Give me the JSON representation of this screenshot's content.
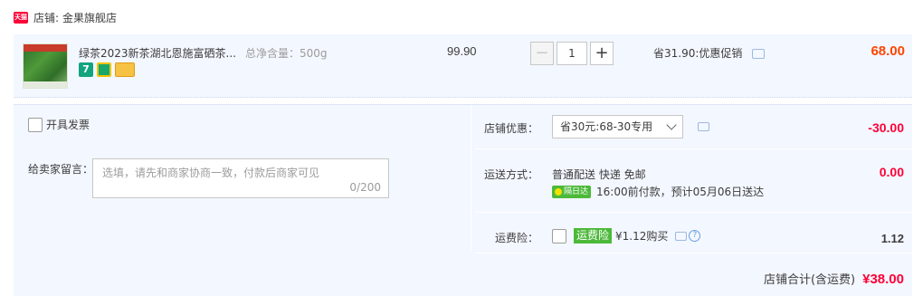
{
  "shop": {
    "badge_text": "天猫",
    "prefix": "店铺:",
    "name": "金果旗舰店"
  },
  "item": {
    "title": "绿茶2023新茶湖北恩施富硒茶...",
    "spec": "总净含量：500g",
    "unit_price": "99.90",
    "quantity": "1",
    "qty_minus": "−",
    "qty_plus": "+",
    "promo": "省31.90:优惠促销",
    "total": "68.00",
    "tag_icons": [
      "seven-day-return-icon",
      "shield-badge-icon",
      "card-icon"
    ],
    "tag1_text": "7"
  },
  "invoice": {
    "label": "开具发票"
  },
  "message": {
    "label": "给卖家留言：",
    "placeholder": "选填，请先和商家协商一致，付款后商家可见",
    "count": "0/200"
  },
  "coupon": {
    "label": "店铺优惠：",
    "selected": "省30元:68-30专用",
    "amount": "-30.00"
  },
  "shipping": {
    "label": "运送方式：",
    "method": "普通配送 快递 免邮",
    "sameday_badge": "隔日达",
    "eta": "16:00前付款，预计05月06日送达",
    "fee": "0.00"
  },
  "insurance": {
    "label": "运费险：",
    "badge": "运费险",
    "price": "¥1.12购买",
    "fee": "1.12"
  },
  "total": {
    "label": "店铺合计(含运费)",
    "value": "¥38.00"
  },
  "colors": {
    "accent_red": "#ff0036",
    "price_orange": "#ff4400",
    "panel_bg": "#f3f7ff",
    "badge_green": "#4cb93a"
  }
}
